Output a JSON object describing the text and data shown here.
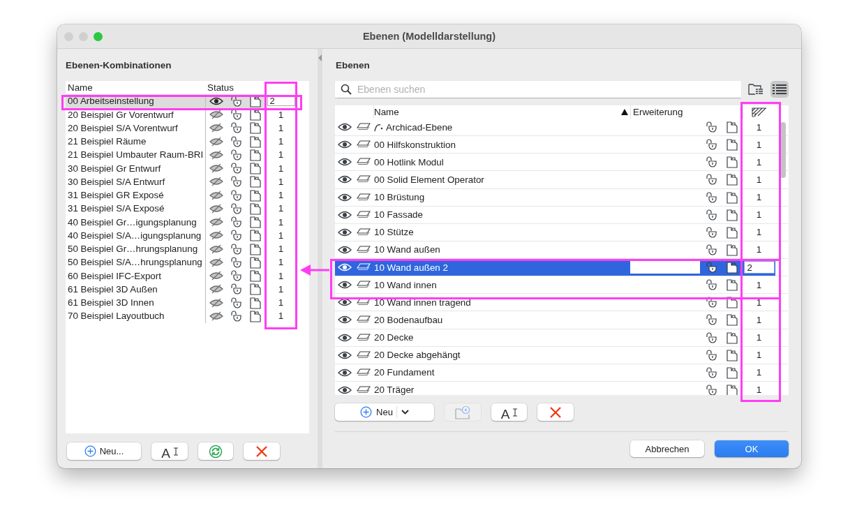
{
  "window": {
    "title": "Ebenen (Modelldarstellung)"
  },
  "combinations": {
    "heading": "Ebenen-Kombinationen",
    "columns": [
      "Name",
      "Status"
    ],
    "rows": [
      {
        "name": "00 Arbeitseinstellung",
        "visible": true,
        "number": "2",
        "selected": true
      },
      {
        "name": "20 Beispiel Gr Vorentwurf",
        "visible": false,
        "number": "1",
        "selected": false
      },
      {
        "name": "20 Beispiel S/A Vorentwurf",
        "visible": false,
        "number": "1",
        "selected": false
      },
      {
        "name": "21 Beispiel Räume",
        "visible": false,
        "number": "1",
        "selected": false
      },
      {
        "name": "21 Beispiel Umbauter Raum-BRI",
        "visible": false,
        "number": "1",
        "selected": false
      },
      {
        "name": "30 Beispiel Gr Entwurf",
        "visible": false,
        "number": "1",
        "selected": false
      },
      {
        "name": "30 Beispiel S/A Entwurf",
        "visible": false,
        "number": "1",
        "selected": false
      },
      {
        "name": "31 Beispiel GR Exposé",
        "visible": false,
        "number": "1",
        "selected": false
      },
      {
        "name": "31 Beispiel S/A Exposé",
        "visible": false,
        "number": "1",
        "selected": false
      },
      {
        "name": "40 Beispiel Gr…igungsplanung",
        "visible": false,
        "number": "1",
        "selected": false
      },
      {
        "name": "40 Beispiel S/A…igungsplanung",
        "visible": false,
        "number": "1",
        "selected": false
      },
      {
        "name": "50 Beispiel Gr…hrungsplanung",
        "visible": false,
        "number": "1",
        "selected": false
      },
      {
        "name": "50 Beispiel S/A…hrungsplanung",
        "visible": false,
        "number": "1",
        "selected": false
      },
      {
        "name": "60 Beispiel IFC-Export",
        "visible": false,
        "number": "1",
        "selected": false
      },
      {
        "name": "61 Beispiel 3D Außen",
        "visible": false,
        "number": "1",
        "selected": false
      },
      {
        "name": "61 Beispiel 3D Innen",
        "visible": false,
        "number": "1",
        "selected": false
      },
      {
        "name": "70 Beispiel Layoutbuch",
        "visible": false,
        "number": "1",
        "selected": false
      }
    ],
    "buttons": [
      {
        "kind": "new",
        "label": "Neu..."
      },
      {
        "kind": "rename",
        "label": "A"
      },
      {
        "kind": "refresh"
      },
      {
        "kind": "delete"
      }
    ]
  },
  "layers": {
    "heading": "Ebenen",
    "search": {
      "placeholder": "Ebenen suchen"
    },
    "view_buttons": [
      {
        "kind": "tree",
        "selected": false
      },
      {
        "kind": "list",
        "selected": true
      }
    ],
    "columns": [
      "Name",
      "Erweiterung"
    ],
    "rows": [
      {
        "kind": "archicad",
        "name": "Archicad-Ebene",
        "number": "1",
        "selected": false
      },
      {
        "kind": "layer",
        "name": "00 Hilfskonstruktion",
        "number": "1",
        "selected": false
      },
      {
        "kind": "layer",
        "name": "00 Hotlink Modul",
        "number": "1",
        "selected": false
      },
      {
        "kind": "layer",
        "name": "00 Solid Element Operator",
        "number": "1",
        "selected": false
      },
      {
        "kind": "layer",
        "name": "10 Brüstung",
        "number": "1",
        "selected": false
      },
      {
        "kind": "layer",
        "name": "10 Fassade",
        "number": "1",
        "selected": false
      },
      {
        "kind": "layer",
        "name": "10 Stütze",
        "number": "1",
        "selected": false
      },
      {
        "kind": "layer",
        "name": "10 Wand außen",
        "number": "1",
        "selected": false
      },
      {
        "kind": "layer",
        "name": "10 Wand außen 2",
        "number": "2",
        "selected": true
      },
      {
        "kind": "layer",
        "name": "10 Wand innen",
        "number": "1",
        "selected": false
      },
      {
        "kind": "layer",
        "name": "10 Wand innen tragend",
        "number": "1",
        "selected": false
      },
      {
        "kind": "layer",
        "name": "20 Bodenaufbau",
        "number": "1",
        "selected": false
      },
      {
        "kind": "layer",
        "name": "20 Decke",
        "number": "1",
        "selected": false
      },
      {
        "kind": "layer",
        "name": "20 Decke abgehängt",
        "number": "1",
        "selected": false
      },
      {
        "kind": "layer",
        "name": "20 Fundament",
        "number": "1",
        "selected": false
      },
      {
        "kind": "layer",
        "name": "20 Träger",
        "number": "1",
        "selected": false
      }
    ],
    "buttons": [
      {
        "kind": "new",
        "label": "Neu"
      },
      {
        "kind": "new-folder",
        "disabled": true
      },
      {
        "kind": "rename",
        "label": "A"
      },
      {
        "kind": "delete"
      }
    ]
  },
  "footer": {
    "buttons": [
      {
        "kind": "cancel",
        "label": "Abbrechen"
      },
      {
        "kind": "ok",
        "label": "OK"
      }
    ]
  }
}
